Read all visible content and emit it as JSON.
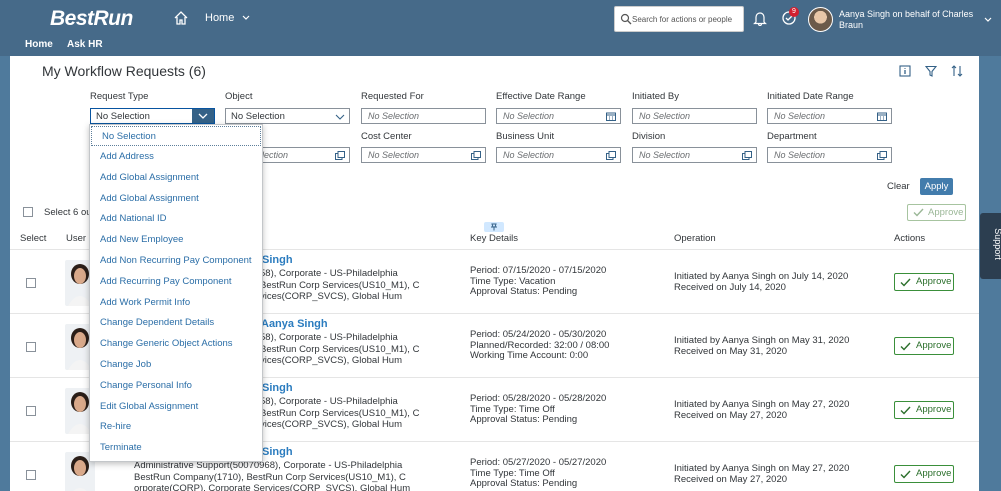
{
  "shell": {
    "logo": "BestRun",
    "home_menu": "Home",
    "search_placeholder": "Search for actions or people",
    "tasks_count": "9",
    "user": "Aanya Singh on behalf of Charles Braun"
  },
  "subnav": {
    "home": "Home",
    "ask_hr": "Ask HR"
  },
  "page": {
    "title": "My Workflow Requests (6)"
  },
  "filters": {
    "request_type": {
      "label": "Request Type",
      "value": "No Selection"
    },
    "object": {
      "label": "Object",
      "value": "No Selection"
    },
    "requested_for": {
      "label": "Requested For",
      "placeholder": "No Selection"
    },
    "effective_date_range": {
      "label": "Effective Date Range",
      "placeholder": "No Selection"
    },
    "initiated_by": {
      "label": "Initiated By",
      "placeholder": "No Selection"
    },
    "initiated_date_range": {
      "label": "Initiated Date Range",
      "placeholder": "No Selection"
    },
    "hidden_field": {
      "placeholder": "lection"
    },
    "cost_center": {
      "label": "Cost Center",
      "placeholder": "No Selection"
    },
    "business_unit": {
      "label": "Business Unit",
      "placeholder": "No Selection"
    },
    "division": {
      "label": "Division",
      "placeholder": "No Selection"
    },
    "department": {
      "label": "Department",
      "placeholder": "No Selection"
    },
    "clear": "Clear",
    "apply": "Apply"
  },
  "table": {
    "select_all": "Select 6 ou",
    "approve_all": "Approve",
    "headers": {
      "select": "Select",
      "user": "User F",
      "key_details": "Key Details",
      "operation": "Operation",
      "actions": "Actions"
    },
    "rows": [
      {
        "name": "Singh",
        "org1": "58), Corporate - US-Philadelphia",
        "org2": "BestRun Corp Services(US10_M1), C",
        "org3": "vices(CORP_SVCS), Global Hum",
        "kd1": "Period: 07/15/2020 - 07/15/2020",
        "kd2": "Time Type: Vacation",
        "kd3": "Approval Status: Pending",
        "op1": "Initiated by Aanya Singh on July 14, 2020",
        "op2": "Received on July 14, 2020",
        "action": "Approve"
      },
      {
        "name": "Aanya Singh",
        "org1": "58), Corporate - US-Philadelphia",
        "org2": "BestRun Corp Services(US10_M1), C",
        "org3": "vices(CORP_SVCS), Global Hum",
        "kd1": "Period: 05/24/2020 - 05/30/2020",
        "kd2": "Planned/Recorded: 32:00 / 08:00",
        "kd3": "Working Time Account: 0:00",
        "op1": "Initiated by Aanya Singh on May 31, 2020",
        "op2": "Received on May 31, 2020",
        "action": "Approve"
      },
      {
        "name": "Singh",
        "org1": "58), Corporate - US-Philadelphia",
        "org2": "BestRun Corp Services(US10_M1), C",
        "org3": "vices(CORP_SVCS), Global Hum",
        "kd1": "Period: 05/28/2020 - 05/28/2020",
        "kd2": "Time Type: Time Off",
        "kd3": "Approval Status: Pending",
        "op1": "Initiated by Aanya Singh on May 27, 2020",
        "op2": "Received on May 27, 2020",
        "action": "Approve"
      },
      {
        "name": "Singh",
        "org1": "Administrative Support(50070968), Corporate - US-Philadelphia",
        "org2": "BestRun Company(1710), BestRun Corp Services(US10_M1), C",
        "org3": "orporate(CORP), Corporate Services(CORP_SVCS), Global Hum",
        "kd1": "Period: 05/27/2020 - 05/27/2020",
        "kd2": "Time Type: Time Off",
        "kd3": "Approval Status: Pending",
        "op1": "Initiated by Aanya Singh on May 27, 2020",
        "op2": "Received on May 27, 2020",
        "action": "Approve"
      }
    ]
  },
  "dropdown": {
    "items": [
      "No Selection",
      "Add Address",
      "Add Global Assignment",
      "Add Global Assignment",
      "Add National ID",
      "Add New Employee",
      "Add Non Recurring Pay Component",
      "Add Recurring Pay Component",
      "Add Work Permit Info",
      "Change Dependent Details",
      "Change Generic Object Actions",
      "Change Job",
      "Change Personal Info",
      "Edit Global Assignment",
      "Re-hire",
      "Terminate"
    ]
  },
  "support": "Support",
  "icons": [
    "home-icon",
    "chevron-down-icon",
    "search-icon",
    "bell-icon",
    "tasks-icon",
    "info-icon",
    "filter-icon",
    "sort-icon",
    "calendar-icon",
    "value-help-icon",
    "checkmark-icon",
    "pin-icon"
  ],
  "colors": {
    "shell": "#466a89",
    "accent": "#427cac",
    "link": "#2b6ea7",
    "approve": "#3a8f3a"
  }
}
